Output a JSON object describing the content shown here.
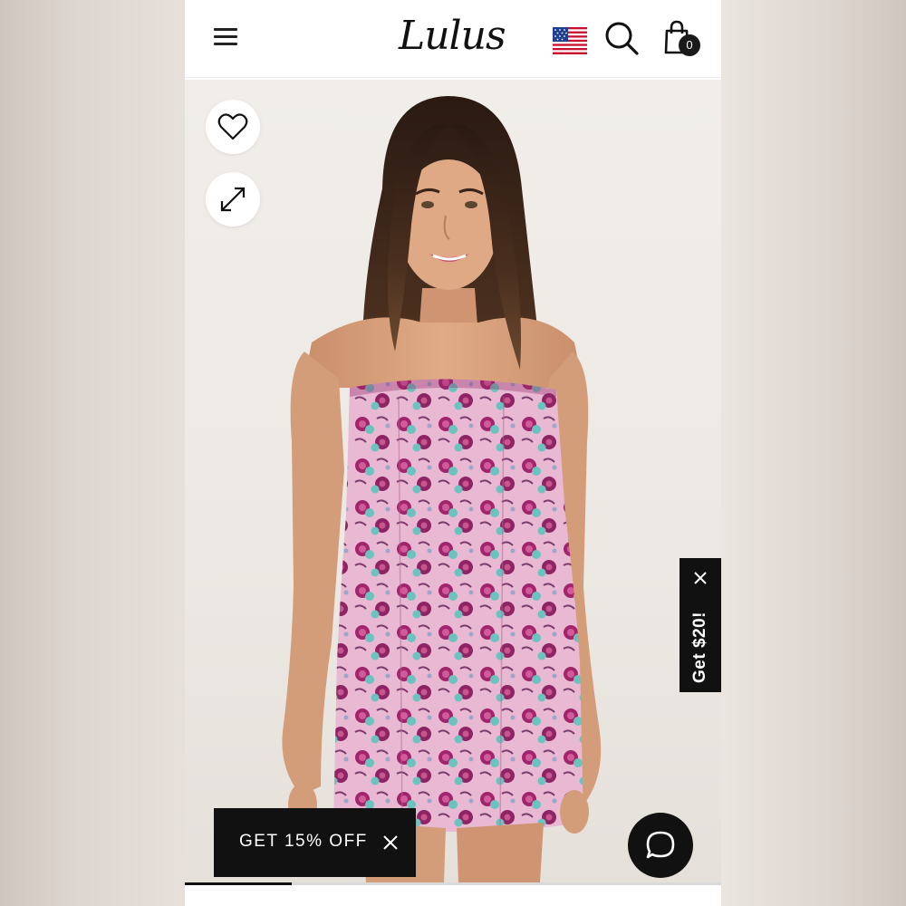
{
  "header": {
    "logo_text": "Lulus",
    "cart_count": "0",
    "menu_icon": "hamburger-menu-icon",
    "flag_icon": "us-flag-icon",
    "search_icon": "search-icon",
    "cart_icon": "shopping-bag-icon"
  },
  "product_image": {
    "description_icons": [
      "heart-icon",
      "expand-icon"
    ],
    "gallery_progress": 0.2
  },
  "promos": {
    "side_tab_label": "Get $20!",
    "offer_label": "GET 15% OFF"
  },
  "chat": {
    "icon": "chat-bubble-icon"
  },
  "colors": {
    "brand_black": "#111111",
    "dress_pink": "#e8b3d0",
    "dress_magenta": "#a0256b",
    "dress_teal": "#6cc3bd",
    "hair": "#3b271b",
    "skin": "#d9a37f"
  }
}
